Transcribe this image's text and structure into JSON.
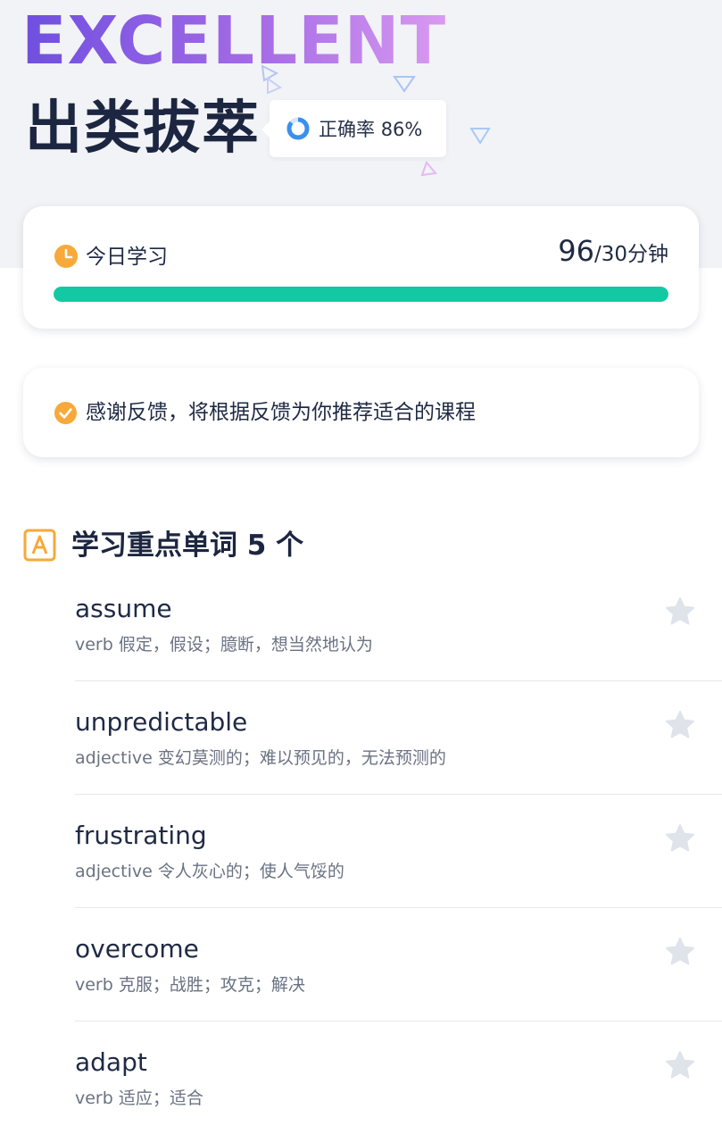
{
  "hero": {
    "badge_text": "EXCELLENT",
    "title": "出类拔萃",
    "accuracy_label": "正确率",
    "accuracy_value": "86%",
    "accuracy_fraction": 0.86
  },
  "study_card": {
    "icon": "clock-icon",
    "label": "今日学习",
    "minutes_done": "96",
    "minutes_goal": "/30分钟",
    "progress_fraction": 1.0
  },
  "feedback_card": {
    "icon": "check-circle-icon",
    "text": "感谢反馈，将根据反馈为你推荐适合的课程"
  },
  "section": {
    "icon": "letter-a-icon",
    "title": "学习重点单词 5 个"
  },
  "words": [
    {
      "word": "assume",
      "definition": "verb 假定，假设；臆断，想当然地认为"
    },
    {
      "word": "unpredictable",
      "definition": "adjective 变幻莫测的；难以预见的，无法预测的"
    },
    {
      "word": "frustrating",
      "definition": "adjective 令人灰心的；使人气馁的"
    },
    {
      "word": "overcome",
      "definition": "verb 克服；战胜；攻克；解决"
    },
    {
      "word": "adapt",
      "definition": "verb 适应；适合"
    }
  ],
  "colors": {
    "accent_green": "#12c9a4",
    "accent_orange": "#f7a93a",
    "accuracy_ring": "#3a8ff0",
    "badge_purple": "#7a55e2",
    "star_gray": "#dfe3ea"
  }
}
